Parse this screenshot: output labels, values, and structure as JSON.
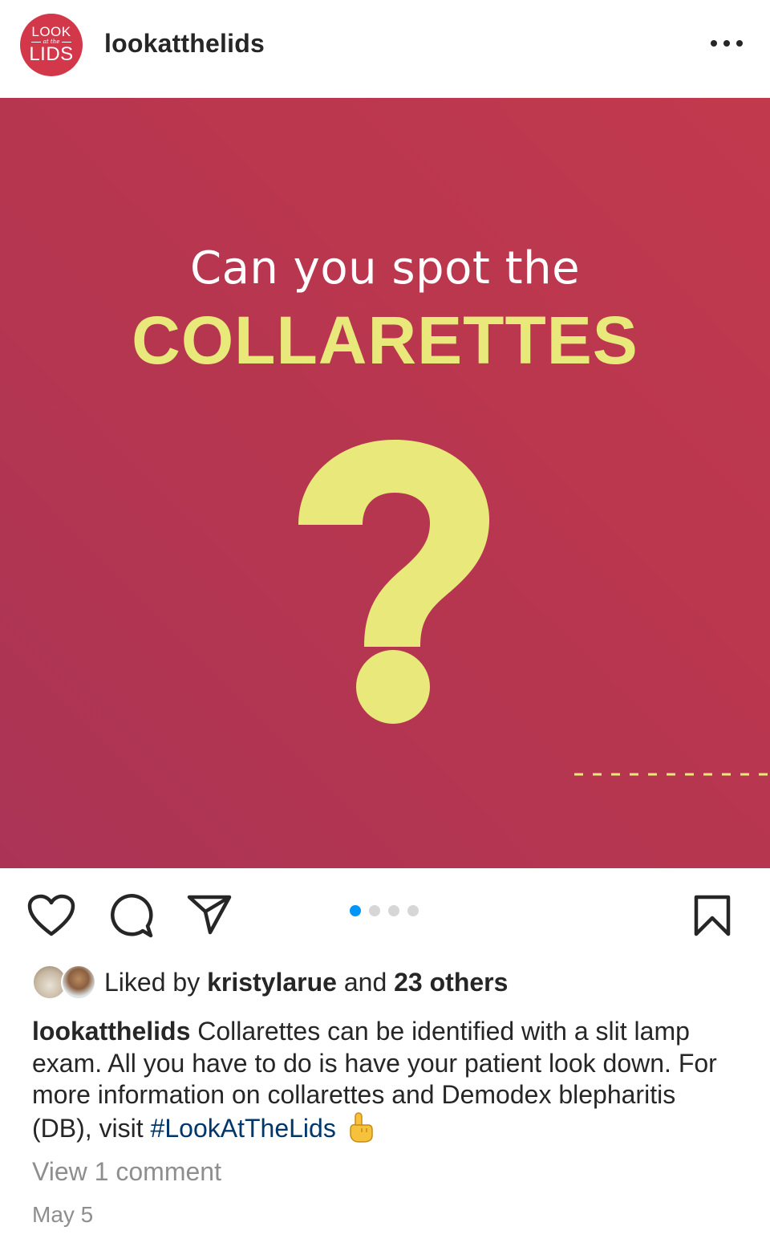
{
  "header": {
    "logo": {
      "top": "LOOK",
      "middle": "at the",
      "bottom": "LIDS"
    },
    "username": "lookatthelids",
    "more_icon": "more-horizontal-icon"
  },
  "post": {
    "image": {
      "line1": "Can you spot the",
      "line2": "COLLARETTES",
      "glyph": "question-mark",
      "background_color": "#b7364f",
      "accent_color": "#e8e97a"
    },
    "carousel": {
      "total": 4,
      "active_index": 0
    },
    "actions": {
      "like_icon": "heart-icon",
      "comment_icon": "comment-icon",
      "share_icon": "send-icon",
      "save_icon": "bookmark-icon"
    },
    "likes": {
      "prefix": "Liked by",
      "user": "kristylarue",
      "middle": "and",
      "others": "23 others"
    },
    "caption": {
      "username": "lookatthelids",
      "text": "Collarettes can be identified with a slit lamp exam. All you have to do is have your patient look down. For more information on collarettes and Demodex blepharitis (DB), visit",
      "hashtag": "#LookAtTheLids",
      "emoji": "pointing-up-hand"
    },
    "view_comments": "View 1 comment",
    "date": "May 5"
  },
  "colors": {
    "link": "#00376b",
    "active_dot": "#0095f6",
    "secondary_text": "#8e8e8e"
  }
}
